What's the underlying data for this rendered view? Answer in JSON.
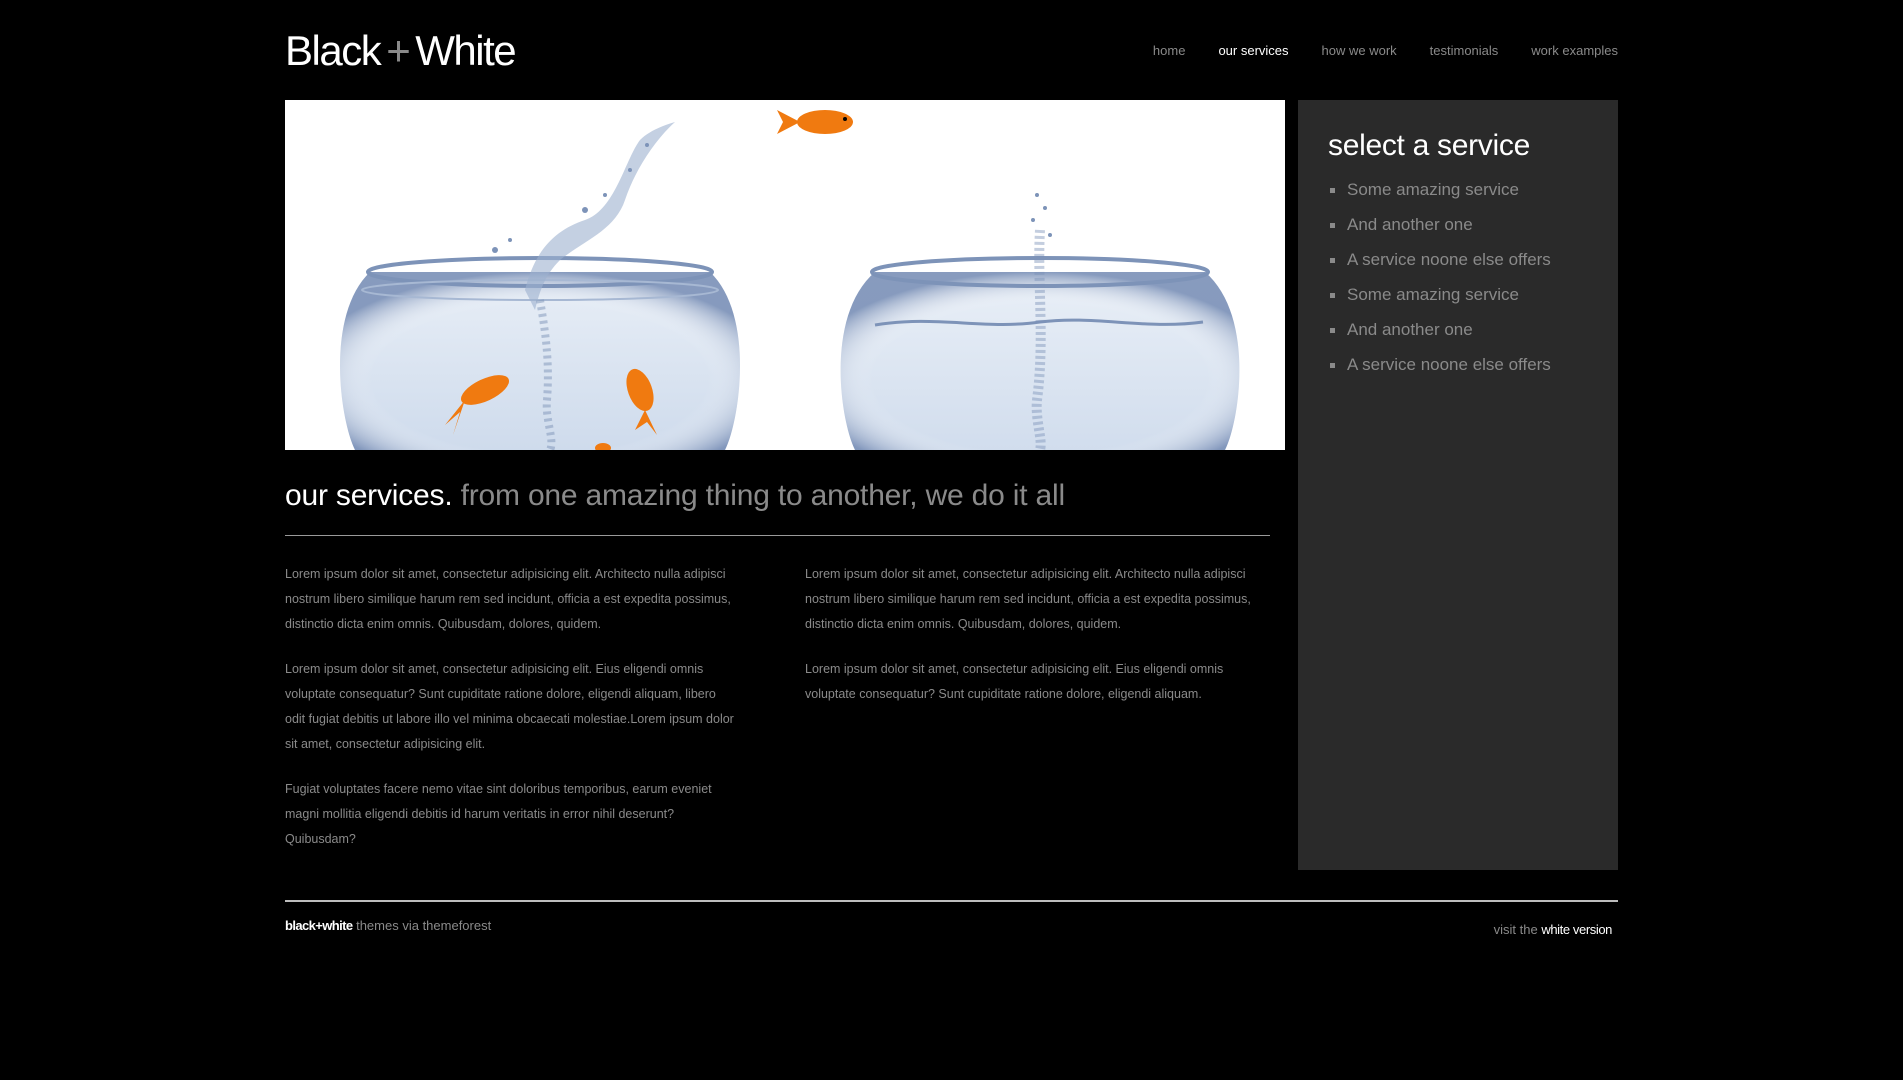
{
  "header": {
    "logo_left": "Black",
    "logo_plus": "+",
    "logo_right": "White",
    "nav": [
      {
        "label": "home",
        "active": false
      },
      {
        "label": "our services",
        "active": true
      },
      {
        "label": "how we work",
        "active": false
      },
      {
        "label": "testimonials",
        "active": false
      },
      {
        "label": "work examples",
        "active": false
      }
    ]
  },
  "main": {
    "headline_strong": "our services.",
    "headline_soft": "from one amazing thing to another, we do it all",
    "col1": [
      "Lorem ipsum dolor sit amet, consectetur adipisicing elit. Architecto nulla adipisci nostrum libero similique harum rem sed incidunt, officia a est expedita possimus, distinctio dicta enim omnis. Quibusdam, dolores, quidem.",
      "Lorem ipsum dolor sit amet, consectetur adipisicing elit. Eius eligendi omnis voluptate consequatur? Sunt cupiditate ratione dolore, eligendi aliquam, libero odit fugiat debitis ut labore illo vel minima obcaecati molestiae.Lorem ipsum dolor sit amet, consectetur adipisicing elit.",
      "Fugiat voluptates facere nemo vitae sint doloribus temporibus, earum eveniet magni mollitia eligendi debitis id harum veritatis in error nihil deserunt? Quibusdam?"
    ],
    "col2": [
      "Lorem ipsum dolor sit amet, consectetur adipisicing elit. Architecto nulla adipisci nostrum libero similique harum rem sed incidunt, officia a est expedita possimus, distinctio dicta enim omnis. Quibusdam, dolores, quidem.",
      "Lorem ipsum dolor sit amet, consectetur adipisicing elit. Eius eligendi omnis voluptate consequatur? Sunt cupiditate ratione dolore, eligendi aliquam."
    ]
  },
  "sidebar": {
    "title": "select a service",
    "items": [
      "Some amazing service",
      "And another one",
      "A service noone else offers",
      "Some amazing service",
      "And another one",
      "A service noone else offers"
    ]
  },
  "footer": {
    "brand": "black+white",
    "brand_suffix": "themes via themeforest",
    "visit_prefix": "visit the",
    "visit_link": "white version"
  },
  "colors": {
    "background": "#000000",
    "sidebar_bg": "#2a2a2a",
    "text_muted": "#8a8a8a",
    "text_bright": "#ffffff",
    "fish": "#f07a10"
  },
  "icons": [
    "goldfish-bowls-image",
    "bullet-square-icon"
  ]
}
